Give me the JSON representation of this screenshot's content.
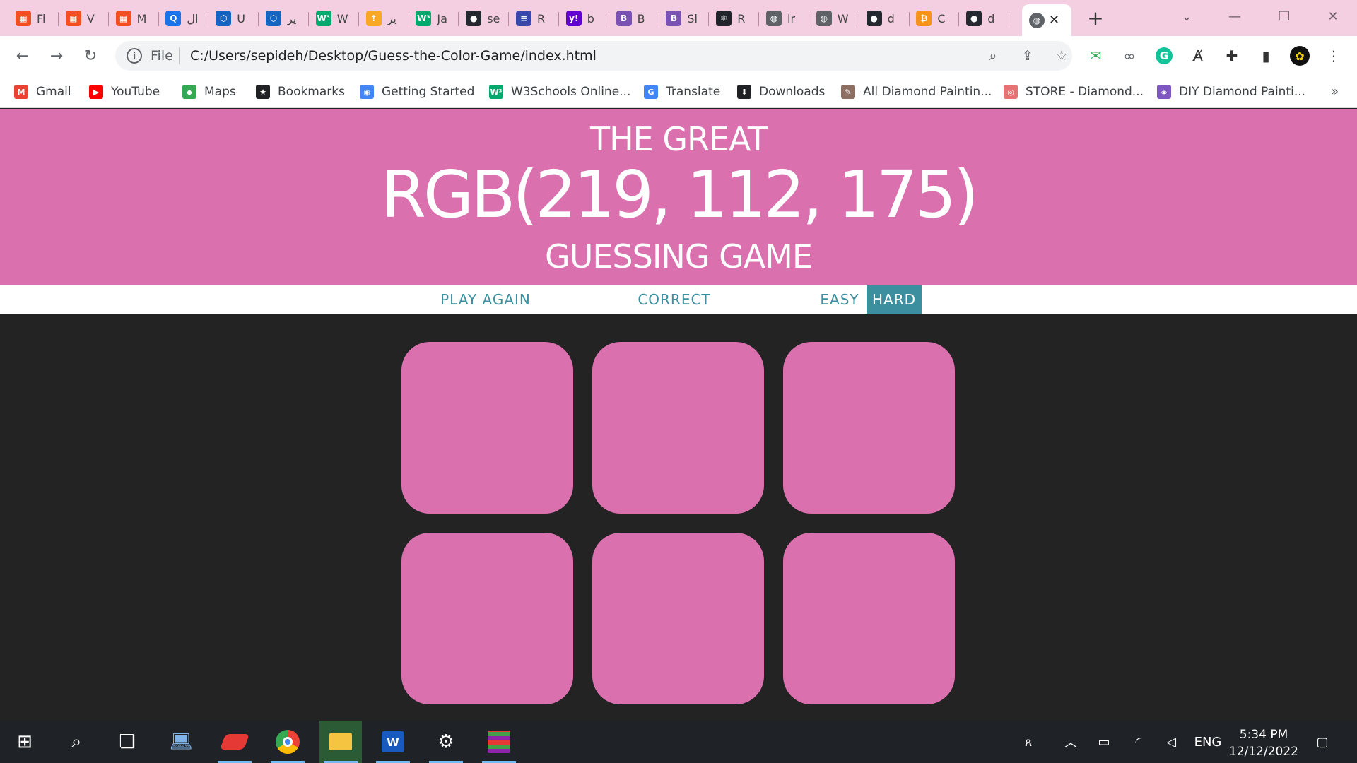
{
  "browser": {
    "tabs": [
      {
        "title": "Fi",
        "favicon": "microsoft-icon",
        "color": "#f25022"
      },
      {
        "title": "V",
        "favicon": "microsoft-icon",
        "color": "#f25022"
      },
      {
        "title": "M",
        "favicon": "microsoft-icon",
        "color": "#f25022"
      },
      {
        "title": "ال",
        "favicon": "q-icon",
        "color": "#1a73e8"
      },
      {
        "title": "U",
        "favicon": "hex-icon",
        "color": "#1565c0"
      },
      {
        "title": "پر",
        "favicon": "hex-icon",
        "color": "#1565c0"
      },
      {
        "title": "W",
        "favicon": "w3-icon",
        "color": "#04aa6d"
      },
      {
        "title": "پر",
        "favicon": "arrow-icon",
        "color": "#f9a825"
      },
      {
        "title": "Ja",
        "favicon": "w3-icon",
        "color": "#04aa6d"
      },
      {
        "title": "se",
        "favicon": "github-icon",
        "color": "#24292f"
      },
      {
        "title": "R",
        "favicon": "stripes-icon",
        "color": "#3949ab"
      },
      {
        "title": "b",
        "favicon": "yahoo-icon",
        "color": "#6001d2"
      },
      {
        "title": "B",
        "favicon": "bootstrap-icon",
        "color": "#7952b3"
      },
      {
        "title": "Sl",
        "favicon": "bootstrap-icon",
        "color": "#7952b3"
      },
      {
        "title": "R",
        "favicon": "react-icon",
        "color": "#20232a"
      },
      {
        "title": "ir",
        "favicon": "globe-icon",
        "color": "#5f6368"
      },
      {
        "title": "W",
        "favicon": "globe-icon",
        "color": "#5f6368"
      },
      {
        "title": "d",
        "favicon": "github-icon",
        "color": "#24292f"
      },
      {
        "title": "C",
        "favicon": "coin-icon",
        "color": "#f7931a"
      },
      {
        "title": "d",
        "favicon": "github-icon",
        "color": "#24292f"
      }
    ],
    "active_tab": {
      "favicon": "globe-icon",
      "close": "✕"
    },
    "new_tab": "+",
    "address": {
      "scheme_label": "File",
      "url": "C:/Users/sepideh/Desktop/Guess-the-Color-Game/index.html"
    },
    "bookmarks": [
      {
        "label": "Gmail",
        "icon": "gmail-icon",
        "color": "#ea4335"
      },
      {
        "label": "YouTube",
        "icon": "youtube-icon",
        "color": "#ff0000"
      },
      {
        "label": "Maps",
        "icon": "maps-icon",
        "color": "#34a853"
      },
      {
        "label": "Bookmarks",
        "icon": "star-icon",
        "color": "#202124"
      },
      {
        "label": "Getting Started",
        "icon": "chrome-icon",
        "color": "#4285f4"
      },
      {
        "label": "W3Schools Online...",
        "icon": "w3-icon",
        "color": "#04aa6d"
      },
      {
        "label": "Translate",
        "icon": "translate-icon",
        "color": "#4285f4"
      },
      {
        "label": "Downloads",
        "icon": "download-icon",
        "color": "#202124"
      },
      {
        "label": "All Diamond Paintin...",
        "icon": "paint-icon",
        "color": "#8d6e63"
      },
      {
        "label": "STORE - Diamond...",
        "icon": "store-icon",
        "color": "#e57373"
      },
      {
        "label": "DIY Diamond Painti...",
        "icon": "diy-icon",
        "color": "#7e57c2"
      }
    ],
    "bookmarks_more": "»"
  },
  "game": {
    "title_top": "THE GREAT",
    "rgb_display": "RGB(219, 112, 175)",
    "title_bottom": "GUESSING GAME",
    "header_color": "#db70af",
    "target_color": "rgb(219, 112, 175)",
    "buttons": {
      "reset": "PLAY AGAIN",
      "message": "CORRECT",
      "easy": "EASY",
      "hard": "HARD"
    },
    "selected_mode": "hard",
    "accent_color": "#3b8f9e",
    "squares": [
      "rgb(219, 112, 175)",
      "rgb(219, 112, 175)",
      "rgb(219, 112, 175)",
      "rgb(219, 112, 175)",
      "rgb(219, 112, 175)",
      "rgb(219, 112, 175)"
    ]
  },
  "taskbar": {
    "apps": [
      "start-icon",
      "search-icon",
      "task-view-icon",
      "laptop-icon",
      "app-red-icon",
      "chrome-icon",
      "file-explorer-icon",
      "word-icon",
      "settings-icon",
      "winrar-icon"
    ],
    "language": "ENG",
    "time": "5:34 PM",
    "date": "12/12/2022"
  }
}
